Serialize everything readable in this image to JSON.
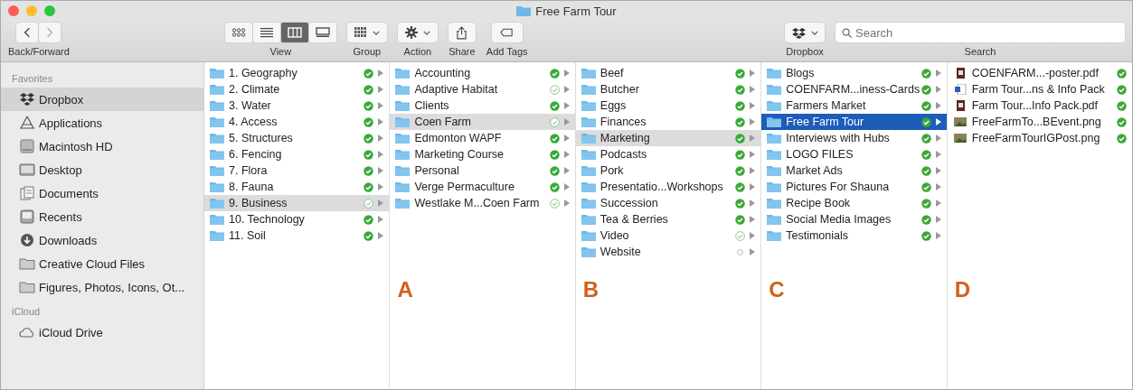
{
  "window": {
    "title": "Free Farm Tour"
  },
  "toolbar": {
    "nav_label": "Back/Forward",
    "view_label": "View",
    "group_label": "Group",
    "action_label": "Action",
    "share_label": "Share",
    "tags_label": "Add Tags",
    "dropbox_label": "Dropbox",
    "search_label": "Search",
    "search": {
      "placeholder": "Search"
    },
    "views": [
      {
        "kind": "icons",
        "selected": false
      },
      {
        "kind": "list",
        "selected": false
      },
      {
        "kind": "columns",
        "selected": true
      },
      {
        "kind": "gallery",
        "selected": false
      }
    ]
  },
  "sidebar": {
    "sections": [
      {
        "header": "Favorites",
        "items": [
          {
            "label": "Dropbox",
            "kind": "dropbox",
            "selected": true
          },
          {
            "label": "Applications",
            "kind": "apps",
            "selected": false
          },
          {
            "label": "Macintosh HD",
            "kind": "disk",
            "selected": false
          },
          {
            "label": "Desktop",
            "kind": "desktop",
            "selected": false
          },
          {
            "label": "Documents",
            "kind": "documents",
            "selected": false
          },
          {
            "label": "Recents",
            "kind": "recents",
            "selected": false
          },
          {
            "label": "Downloads",
            "kind": "downloads",
            "selected": false
          },
          {
            "label": "Creative Cloud Files",
            "kind": "folder",
            "selected": false
          },
          {
            "label": "Figures, Photos, Icons, Ot...",
            "kind": "folder",
            "selected": false
          }
        ]
      },
      {
        "header": "iCloud",
        "items": [
          {
            "label": "iCloud Drive",
            "kind": "cloud",
            "selected": false
          }
        ]
      }
    ]
  },
  "columns": [
    {
      "active": false,
      "rows": [
        {
          "name": "1. Geography",
          "kind": "folder",
          "synced": true,
          "pending": false,
          "selected": false
        },
        {
          "name": "2. Climate",
          "kind": "folder",
          "synced": true,
          "pending": false,
          "selected": false
        },
        {
          "name": "3. Water",
          "kind": "folder",
          "synced": true,
          "pending": false,
          "selected": false
        },
        {
          "name": "4. Access",
          "kind": "folder",
          "synced": true,
          "pending": false,
          "selected": false
        },
        {
          "name": "5. Structures",
          "kind": "folder",
          "synced": true,
          "pending": false,
          "selected": false
        },
        {
          "name": "6. Fencing",
          "kind": "folder",
          "synced": true,
          "pending": false,
          "selected": false
        },
        {
          "name": "7. Flora",
          "kind": "folder",
          "synced": true,
          "pending": false,
          "selected": false
        },
        {
          "name": "8. Fauna",
          "kind": "folder",
          "synced": true,
          "pending": false,
          "selected": false
        },
        {
          "name": "9. Business",
          "kind": "folder",
          "synced": false,
          "pending": false,
          "selected": true
        },
        {
          "name": "10. Technology",
          "kind": "folder",
          "synced": true,
          "pending": false,
          "selected": false
        },
        {
          "name": "11. Soil",
          "kind": "folder",
          "synced": true,
          "pending": false,
          "selected": false
        }
      ]
    },
    {
      "active": false,
      "annotation": "A",
      "rows": [
        {
          "name": "Accounting",
          "kind": "folder",
          "synced": true,
          "pending": false,
          "selected": false
        },
        {
          "name": "Adaptive Habitat",
          "kind": "folder",
          "synced": false,
          "pending": false,
          "selected": false
        },
        {
          "name": "Clients",
          "kind": "folder",
          "synced": true,
          "pending": false,
          "selected": false
        },
        {
          "name": "Coen Farm",
          "kind": "folder",
          "synced": false,
          "pending": false,
          "selected": true
        },
        {
          "name": "Edmonton WAPF",
          "kind": "folder",
          "synced": true,
          "pending": false,
          "selected": false
        },
        {
          "name": "Marketing Course",
          "kind": "folder",
          "synced": true,
          "pending": false,
          "selected": false
        },
        {
          "name": "Personal",
          "kind": "folder",
          "synced": true,
          "pending": false,
          "selected": false
        },
        {
          "name": "Verge Permaculture",
          "kind": "folder",
          "synced": true,
          "pending": false,
          "selected": false
        },
        {
          "name": "Westlake M...Coen Farm",
          "kind": "folder",
          "synced": false,
          "pending": false,
          "selected": false
        }
      ]
    },
    {
      "active": false,
      "annotation": "B",
      "rows": [
        {
          "name": "Beef",
          "kind": "folder",
          "synced": true,
          "pending": false,
          "selected": false
        },
        {
          "name": "Butcher",
          "kind": "folder",
          "synced": true,
          "pending": false,
          "selected": false
        },
        {
          "name": "Eggs",
          "kind": "folder",
          "synced": true,
          "pending": false,
          "selected": false
        },
        {
          "name": "Finances",
          "kind": "folder",
          "synced": true,
          "pending": false,
          "selected": false
        },
        {
          "name": "Marketing",
          "kind": "folder",
          "synced": true,
          "pending": false,
          "selected": true
        },
        {
          "name": "Podcasts",
          "kind": "folder",
          "synced": true,
          "pending": false,
          "selected": false
        },
        {
          "name": "Pork",
          "kind": "folder",
          "synced": true,
          "pending": false,
          "selected": false
        },
        {
          "name": "Presentatio...Workshops",
          "kind": "folder",
          "synced": true,
          "pending": false,
          "selected": false
        },
        {
          "name": "Succession",
          "kind": "folder",
          "synced": true,
          "pending": false,
          "selected": false
        },
        {
          "name": "Tea & Berries",
          "kind": "folder",
          "synced": true,
          "pending": false,
          "selected": false
        },
        {
          "name": "Video",
          "kind": "folder",
          "synced": false,
          "pending": false,
          "selected": false
        },
        {
          "name": "Website",
          "kind": "folder",
          "synced": false,
          "pending": true,
          "selected": false
        }
      ]
    },
    {
      "active": true,
      "annotation": "C",
      "rows": [
        {
          "name": "Blogs",
          "kind": "folder",
          "synced": true,
          "pending": false,
          "selected": false
        },
        {
          "name": "COENFARM...iness-Cards",
          "kind": "folder",
          "synced": true,
          "pending": false,
          "selected": false
        },
        {
          "name": "Farmers Market",
          "kind": "folder",
          "synced": true,
          "pending": false,
          "selected": false
        },
        {
          "name": "Free Farm Tour",
          "kind": "folder",
          "synced": true,
          "pending": false,
          "selected": true
        },
        {
          "name": "Interviews with Hubs",
          "kind": "folder",
          "synced": true,
          "pending": false,
          "selected": false
        },
        {
          "name": "LOGO FILES",
          "kind": "folder",
          "synced": true,
          "pending": false,
          "selected": false
        },
        {
          "name": "Market Ads",
          "kind": "folder",
          "synced": true,
          "pending": false,
          "selected": false
        },
        {
          "name": "Pictures For Shauna",
          "kind": "folder",
          "synced": true,
          "pending": false,
          "selected": false
        },
        {
          "name": "Recipe Book",
          "kind": "folder",
          "synced": true,
          "pending": false,
          "selected": false
        },
        {
          "name": "Social Media Images",
          "kind": "folder",
          "synced": true,
          "pending": false,
          "selected": false
        },
        {
          "name": "Testimonials",
          "kind": "folder",
          "synced": true,
          "pending": false,
          "selected": false
        }
      ]
    },
    {
      "annotation": "D",
      "rows": [
        {
          "name": "COENFARM...-poster.pdf",
          "kind": "pdf",
          "synced": true,
          "pending": false,
          "selected": false
        },
        {
          "name": "Farm Tour...ns & Info Pack",
          "kind": "doc",
          "synced": true,
          "pending": false,
          "selected": false
        },
        {
          "name": "Farm Tour...Info Pack.pdf",
          "kind": "pdf",
          "synced": true,
          "pending": false,
          "selected": false
        },
        {
          "name": "FreeFarmTo...BEvent.png",
          "kind": "image",
          "synced": true,
          "pending": false,
          "selected": false
        },
        {
          "name": "FreeFarmTourIGPost.png",
          "kind": "image",
          "synced": true,
          "pending": false,
          "selected": false
        }
      ]
    }
  ]
}
